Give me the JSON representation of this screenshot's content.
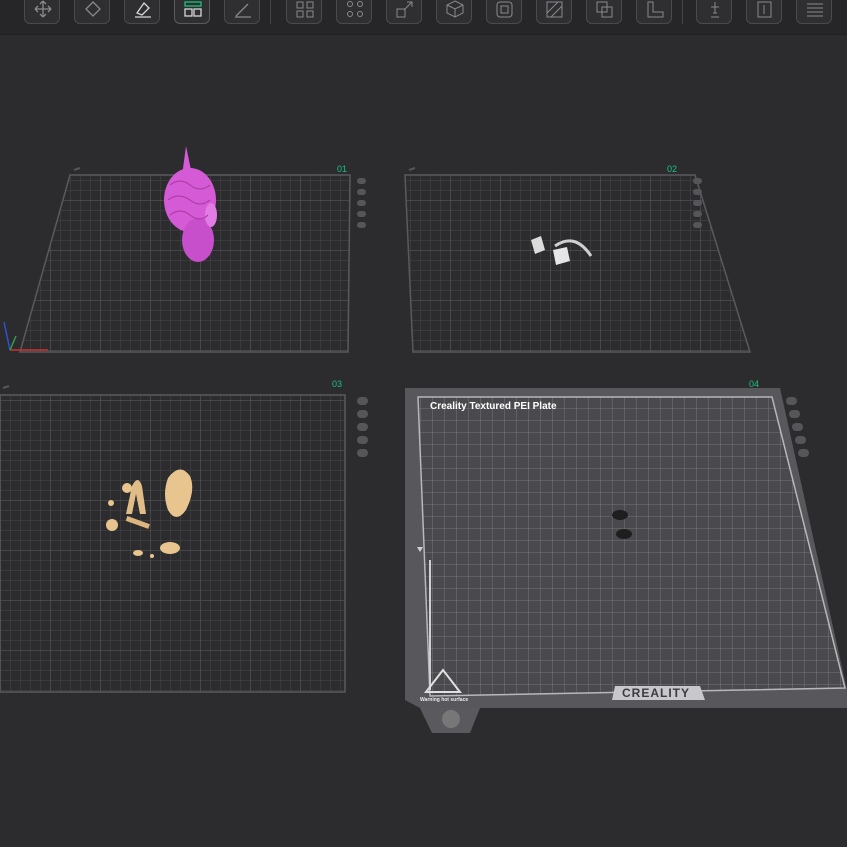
{
  "toolbar": {
    "buttons": [
      {
        "name": "move-tool",
        "icon": "move-icon",
        "active": false
      },
      {
        "name": "rotate-tool",
        "icon": "rotate-icon",
        "active": false
      },
      {
        "name": "place-on-face-tool",
        "icon": "place-face-icon",
        "active": false
      },
      {
        "name": "arrange-plates-tool",
        "icon": "arrange-icon",
        "active": true
      },
      {
        "name": "paint-tool",
        "icon": "brush-icon",
        "active": false
      },
      {
        "name": "multi-plate-tool",
        "icon": "grid-icon",
        "active": false
      },
      {
        "name": "auto-orient-tool",
        "icon": "orient-icon",
        "active": false
      },
      {
        "name": "scale-tool",
        "icon": "scale-icon",
        "active": false
      },
      {
        "name": "cut-tool",
        "icon": "cube-cut-icon",
        "active": false
      },
      {
        "name": "hollow-tool",
        "icon": "hollow-icon",
        "active": false
      },
      {
        "name": "support-paint-tool",
        "icon": "support-icon",
        "active": false
      },
      {
        "name": "boolean-tool",
        "icon": "boolean-icon",
        "active": false
      },
      {
        "name": "measure-tool",
        "icon": "measure-icon",
        "active": false
      },
      {
        "name": "assembly-tool",
        "icon": "assembly-icon",
        "active": false
      },
      {
        "name": "text-tool",
        "icon": "text-icon",
        "active": false
      },
      {
        "name": "layers-tool",
        "icon": "layers-icon",
        "active": false
      }
    ],
    "accent": "#19c37d"
  },
  "plates": [
    {
      "label": "01"
    },
    {
      "label": "02"
    },
    {
      "label": "03"
    },
    {
      "label": "04",
      "bed_title": "Creality Textured PEI Plate",
      "brand": "CREALITY",
      "warning": "Warning hot surface"
    }
  ],
  "colors": {
    "background": "#2c2c2e",
    "grid": "#4e4e52",
    "model_pink": "#d45ad6",
    "model_beige": "#e8c58e",
    "model_white": "#e0e0e0",
    "accent_green": "#19c37d"
  }
}
